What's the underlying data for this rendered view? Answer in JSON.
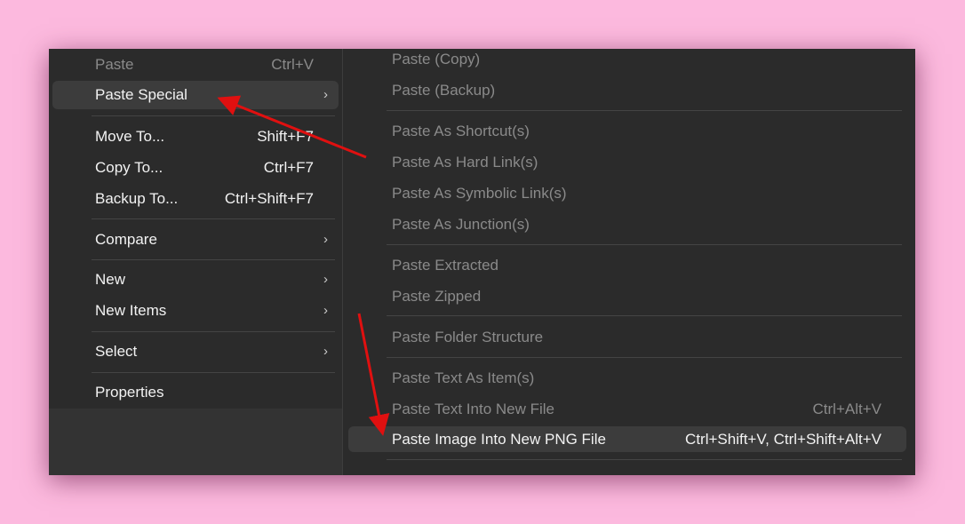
{
  "left_menu": {
    "items": [
      {
        "label": "Paste",
        "shortcut": "Ctrl+V"
      },
      {
        "label": "Paste Special"
      },
      {
        "label": "Move To...",
        "shortcut": "Shift+F7"
      },
      {
        "label": "Copy To...",
        "shortcut": "Ctrl+F7"
      },
      {
        "label": "Backup To...",
        "shortcut": "Ctrl+Shift+F7"
      },
      {
        "label": "Compare"
      },
      {
        "label": "New"
      },
      {
        "label": "New Items"
      },
      {
        "label": "Select"
      },
      {
        "label": "Properties"
      }
    ]
  },
  "submenu": {
    "items": [
      {
        "label": "Paste (Copy)"
      },
      {
        "label": "Paste (Backup)"
      },
      {
        "label": "Paste As Shortcut(s)"
      },
      {
        "label": "Paste As Hard Link(s)"
      },
      {
        "label": "Paste As Symbolic Link(s)"
      },
      {
        "label": "Paste As Junction(s)"
      },
      {
        "label": "Paste Extracted"
      },
      {
        "label": "Paste Zipped"
      },
      {
        "label": "Paste Folder Structure"
      },
      {
        "label": "Paste Text As Item(s)"
      },
      {
        "label": "Paste Text Into New File",
        "shortcut": "Ctrl+Alt+V"
      },
      {
        "label": "Paste Image Into New PNG File",
        "shortcut": "Ctrl+Shift+V, Ctrl+Shift+Alt+V"
      }
    ]
  },
  "colors": {
    "background": "#fcb9de",
    "menu": "#2b2b2b",
    "highlight": "#3c3c3c",
    "annotation_arrow": "#e01010"
  },
  "chevron": "›"
}
